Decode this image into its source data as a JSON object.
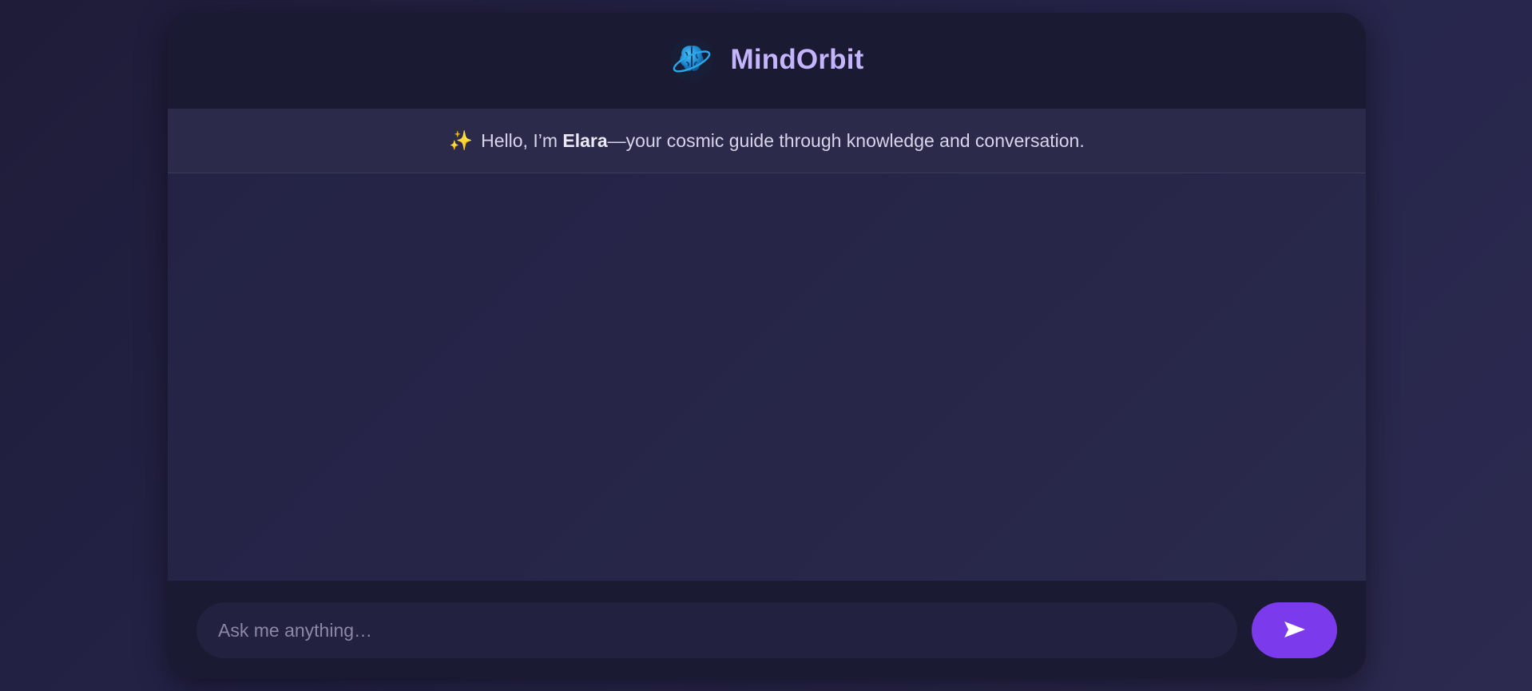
{
  "app": {
    "title": "MindOrbit",
    "logo_icon": "brain-orbit-icon",
    "colors": {
      "accent": "#7c3aed",
      "title": "#c4b5fd",
      "logo": "#1e90d6"
    }
  },
  "welcome": {
    "icon": "sparkles-icon",
    "icon_glyph": "✨",
    "prefix": "Hello, I’m ",
    "assistant_name": "Elara",
    "suffix": "—your cosmic guide through knowledge and conversation."
  },
  "composer": {
    "placeholder": "Ask me anything…",
    "value": "",
    "send_icon": "send-arrow-icon"
  }
}
